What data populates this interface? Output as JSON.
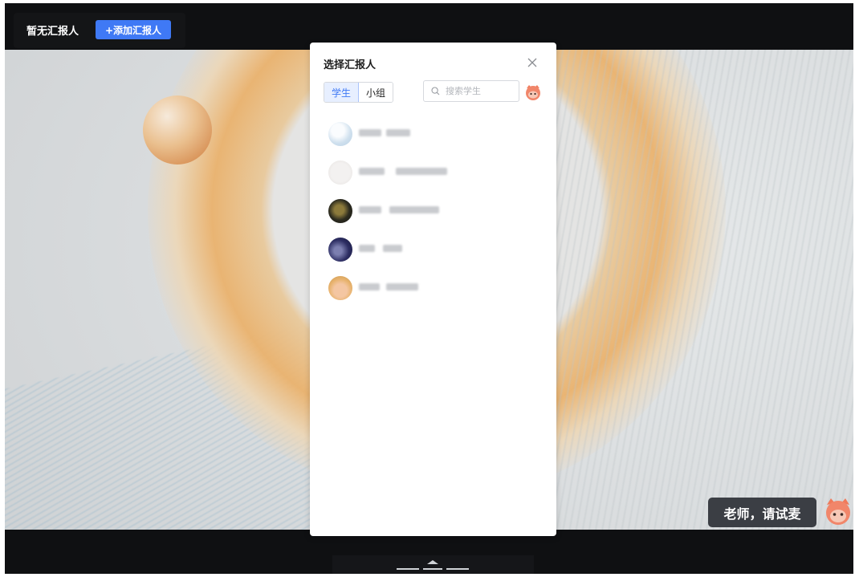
{
  "topbar": {
    "no_reporter_label": "暂无汇报人",
    "add_reporter_button": "+添加汇报人"
  },
  "modal": {
    "title": "选择汇报人",
    "tabs": [
      {
        "label": "学生",
        "active": true
      },
      {
        "label": "小组",
        "active": false
      }
    ],
    "search": {
      "placeholder": "搜索学生"
    },
    "students": [
      {
        "name": ""
      },
      {
        "name": ""
      },
      {
        "name": ""
      },
      {
        "name": ""
      },
      {
        "name": ""
      }
    ]
  },
  "footer": {
    "teacher_button": "老师，请试麦"
  },
  "colors": {
    "accent": "#3f79f5",
    "stage": "#0f1012",
    "modal_bg": "#ffffff",
    "chat_bg": "#3b3e44"
  },
  "icons": [
    "close-icon",
    "search-icon",
    "mascot-icon",
    "chevron-up-icon"
  ]
}
